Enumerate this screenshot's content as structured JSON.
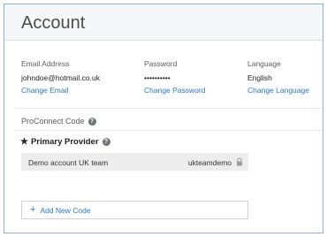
{
  "header": {
    "title": "Account"
  },
  "account": {
    "email": {
      "label": "Email Address",
      "value": "johndoe@hotmail.co.uk",
      "action": "Change Email"
    },
    "password": {
      "label": "Password",
      "value": "••••••••••",
      "action": "Change Password"
    },
    "language": {
      "label": "Language",
      "value": "English",
      "action": "Change Language"
    }
  },
  "proconnect": {
    "label": "ProConnect Code",
    "help_glyph": "?",
    "primary_label": "Primary Provider",
    "star_glyph": "★",
    "code_row": {
      "name": "Demo account UK team",
      "code": "ukteamdemo"
    },
    "add_label": "Add New Code",
    "add_glyph": "+"
  },
  "colors": {
    "link": "#2a78c7",
    "frame_border": "#8fb0d8",
    "row_bg": "#ededee"
  },
  "icons": [
    "help-icon",
    "star-icon",
    "lock-icon",
    "plus-icon"
  ]
}
